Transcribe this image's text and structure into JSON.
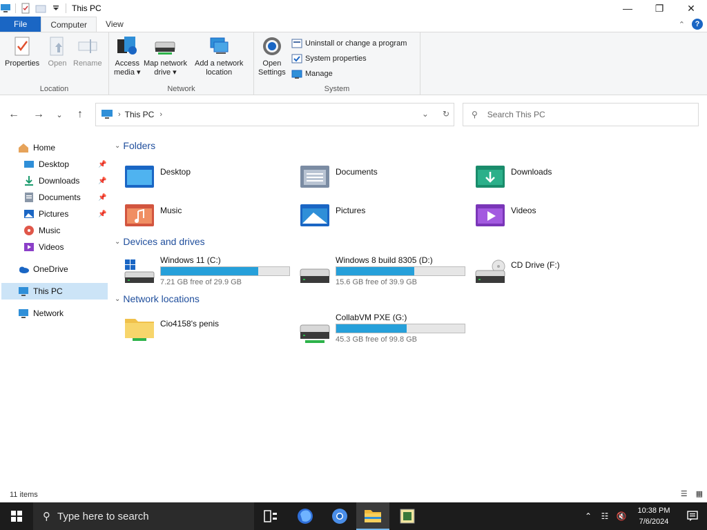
{
  "window": {
    "title": "This PC"
  },
  "ribbon_tabs": {
    "file": "File",
    "computer": "Computer",
    "view": "View"
  },
  "ribbon": {
    "location": {
      "label": "Location",
      "properties": "Properties",
      "open": "Open",
      "rename": "Rename"
    },
    "network": {
      "label": "Network",
      "access_media_1": "Access",
      "access_media_2": "media ▾",
      "map_drive_1": "Map network",
      "map_drive_2": "drive ▾",
      "add_location_1": "Add a network",
      "add_location_2": "location"
    },
    "system": {
      "label": "System",
      "open_settings_1": "Open",
      "open_settings_2": "Settings",
      "uninstall": "Uninstall or change a program",
      "system_properties": "System properties",
      "manage": "Manage"
    }
  },
  "address": {
    "crumb": "This PC",
    "search_placeholder": "Search This PC"
  },
  "sidebar": {
    "home": "Home",
    "desktop": "Desktop",
    "downloads": "Downloads",
    "documents": "Documents",
    "pictures": "Pictures",
    "music": "Music",
    "videos": "Videos",
    "onedrive": "OneDrive",
    "this_pc": "This PC",
    "network": "Network"
  },
  "sections": {
    "folders": "Folders",
    "devices": "Devices and drives",
    "network": "Network locations"
  },
  "folders": [
    "Desktop",
    "Documents",
    "Downloads",
    "Music",
    "Pictures",
    "Videos"
  ],
  "drives": [
    {
      "name": "Windows 11 (C:)",
      "free": "7.21 GB free of 29.9 GB",
      "used_fraction": 0.76
    },
    {
      "name": "Windows 8 build 8305 (D:)",
      "free": "15.6 GB free of 39.9 GB",
      "used_fraction": 0.61
    },
    {
      "name": "CD Drive (F:)"
    }
  ],
  "network_locations": [
    {
      "name": "Cio4158's penis"
    },
    {
      "name": "CollabVM PXE (G:)",
      "free": "45.3 GB free of 99.8 GB",
      "used_fraction": 0.55
    }
  ],
  "status": {
    "items": "11 items"
  },
  "taskbar": {
    "search_placeholder": "Type here to search",
    "time": "10:38 PM",
    "date": "7/6/2024"
  },
  "colors": {
    "accent": "#1a66c4",
    "bar_fill": "#26a0da",
    "section_title": "#1f4e9c",
    "taskbar": "#1c1c1c"
  }
}
